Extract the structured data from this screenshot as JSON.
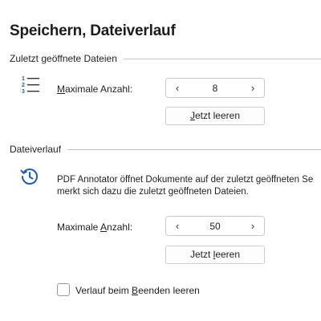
{
  "page": {
    "title": "Speichern, Dateiverlauf"
  },
  "recent_files": {
    "header": "Zuletzt geöffnete Dateien",
    "icon": "numbered-list-icon",
    "max_label_prefix": "",
    "max_label_accel": "M",
    "max_label_rest": "aximale Anzahl:",
    "max_value": "8",
    "clear_button_prefix": "",
    "clear_button_accel": "J",
    "clear_button_rest": "etzt leeren"
  },
  "history": {
    "header": "Dateiverlauf",
    "icon": "history-clock-icon",
    "description_line1": "PDF Annotator öffnet Dokumente auf der zuletzt geöffneten Se",
    "description_line2": "merkt sich dazu die zuletzt geöffneten Dateien.",
    "max_label_prefix": "Maximale ",
    "max_label_accel": "A",
    "max_label_rest": "nzahl:",
    "max_value": "50",
    "clear_button_prefix": "Jetzt ",
    "clear_button_accel": "l",
    "clear_button_rest": "eeren",
    "checkbox_prefix": "Verlauf beim ",
    "checkbox_accel": "B",
    "checkbox_rest": "eenden leeren",
    "checkbox_checked": false
  },
  "stepper": {
    "decrement_glyph": "‹",
    "increment_glyph": "›"
  },
  "colors": {
    "accent": "#1f5fa8",
    "divider": "#c8c8c8"
  }
}
